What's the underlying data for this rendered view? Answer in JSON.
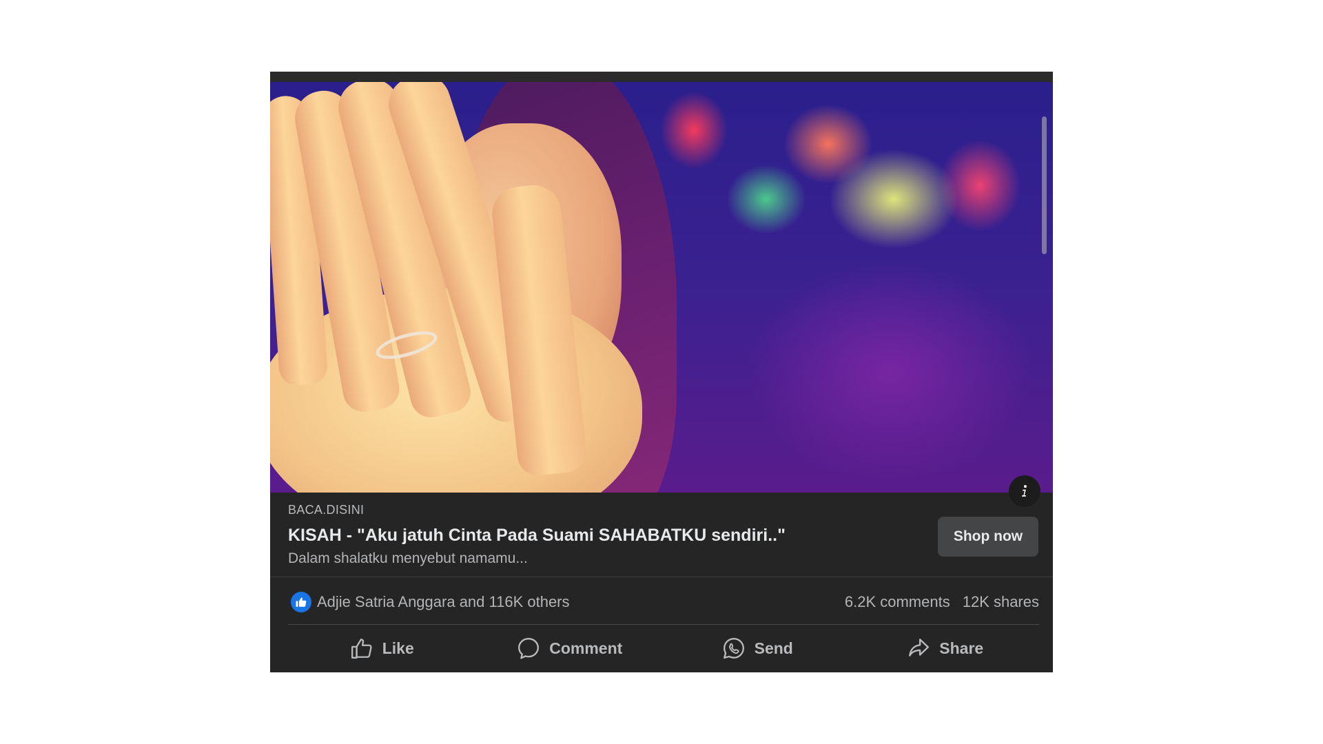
{
  "post": {
    "image_alt": "Woman in hijab covering her face with her hands against colorful bokeh lights",
    "link_preview": {
      "domain": "BACA.DISINI",
      "headline": "KISAH - \"Aku jatuh Cinta Pada Suami SAHABATKU sendiri..\"",
      "description": "Dalam shalatku menyebut namamu...",
      "cta_label": "Shop now"
    },
    "stats": {
      "reactors": "Adjie Satria Anggara and 116K others",
      "comments": "6.2K comments",
      "shares": "12K shares"
    },
    "actions": [
      {
        "label": "Like",
        "icon": "thumbs-up-icon"
      },
      {
        "label": "Comment",
        "icon": "comment-bubble-icon"
      },
      {
        "label": "Send",
        "icon": "whatsapp-icon"
      },
      {
        "label": "Share",
        "icon": "share-arrow-icon"
      }
    ]
  },
  "colors": {
    "card_bg": "#252526",
    "like_badge": "#1b74e4",
    "button_bg": "#444547",
    "text_primary": "#e8e9ea",
    "text_secondary": "#b4b5b7"
  }
}
